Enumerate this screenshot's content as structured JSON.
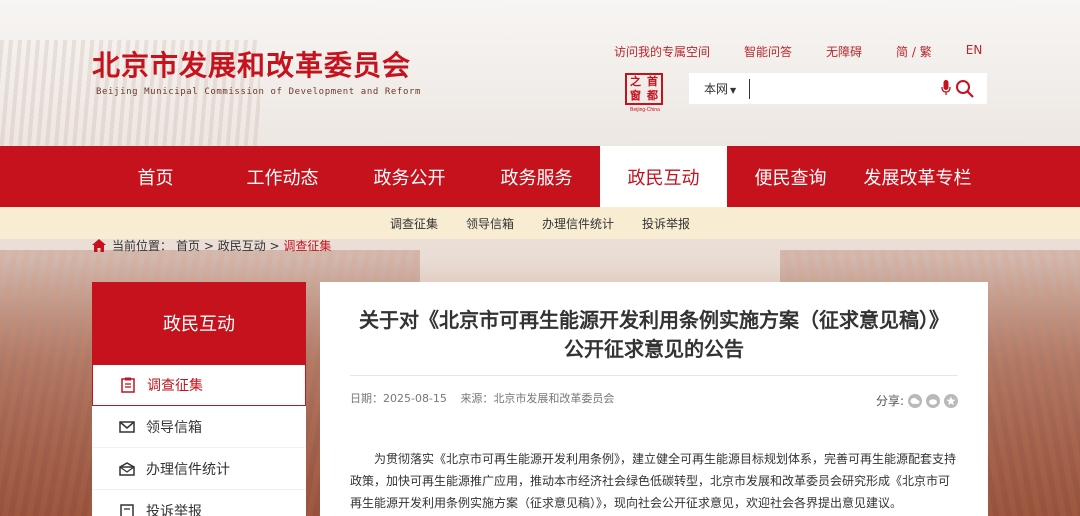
{
  "header": {
    "title": "北京市发展和改革委员会",
    "subtitle": "Beijing Municipal Commission of Development and Reform",
    "top_links": [
      "访问我的专属空间",
      "智能问答",
      "无障碍",
      "简 / 繁",
      "EN"
    ],
    "seal": {
      "chars": [
        "首",
        "之",
        "都",
        "窗"
      ],
      "caption": "Beijing-China"
    }
  },
  "search": {
    "scope": "本网",
    "value": ""
  },
  "main_nav": [
    "首页",
    "工作动态",
    "政务公开",
    "政务服务",
    "政民互动",
    "便民查询",
    "发展改革专栏"
  ],
  "main_nav_active": 4,
  "sub_nav": [
    "调查征集",
    "领导信箱",
    "办理信件统计",
    "投诉举报"
  ],
  "breadcrumb": {
    "label": "当前位置：",
    "items": [
      "首页",
      "政民互动",
      "调查征集"
    ]
  },
  "sidebar": {
    "heading": "政民互动",
    "items": [
      "调查征集",
      "领导信箱",
      "办理信件统计",
      "投诉举报"
    ]
  },
  "article": {
    "title": "关于对《北京市可再生能源开发利用条例实施方案（征求意见稿）》公开征求意见的公告",
    "date": "日期：2025-08-15",
    "source": "来源：北京市发展和改革委员会",
    "share_label": "分享:",
    "body": "为贯彻落实《北京市可再生能源开发利用条例》，建立健全可再生能源目标规划体系，完善可再生能源配套支持政策，加快可再生能源推广应用，推动本市经济社会绿色低碳转型，北京市发展和改革委员会研究形成《北京市可再生能源开发利用条例实施方案（征求意见稿）》，现向社会公开征求意见，欢迎社会各界提出意见建议。"
  }
}
